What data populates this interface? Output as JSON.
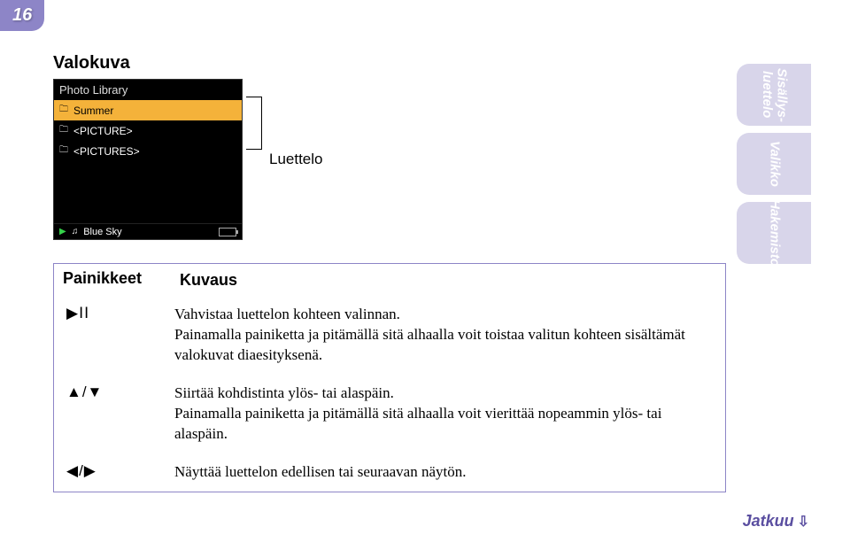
{
  "page_number": "16",
  "section_title": "Valokuva",
  "screenshot": {
    "title": "Photo Library",
    "items": [
      {
        "icon": "folder",
        "label": "Summer",
        "highlight": true
      },
      {
        "icon": "folder",
        "label": "<PICTURE>",
        "highlight": false
      },
      {
        "icon": "folder",
        "label": "<PICTURES>",
        "highlight": false
      }
    ],
    "status_track": "Blue Sky"
  },
  "bracket_label": "Luettelo",
  "table": {
    "header": {
      "col1": "Painikkeet",
      "col2": "Kuvaus"
    },
    "rows": [
      {
        "icon": "play-pause",
        "text": "Vahvistaa luettelon kohteen valinnan.\nPainamalla painiketta ja pitämällä sitä alhaalla voit toistaa valitun kohteen sisältämät valokuvat diaesityksenä."
      },
      {
        "icon": "up-down",
        "text": "Siirtää kohdistinta ylös- tai alaspäin.\nPainamalla painiketta ja pitämällä sitä alhaalla voit vierittää nopeammin ylös- tai alaspäin."
      },
      {
        "icon": "left-right",
        "text": "Näyttää luettelon edellisen tai seuraavan näytön."
      }
    ]
  },
  "side_tabs": [
    "Sisällys-\nluettelo",
    "Valikko",
    "Hakemisto"
  ],
  "continue_label": "Jatkuu",
  "glyphs": {
    "play-pause": "▶ⅠⅠ",
    "up-down": "▲/▼",
    "left-right": "◀/▶"
  }
}
